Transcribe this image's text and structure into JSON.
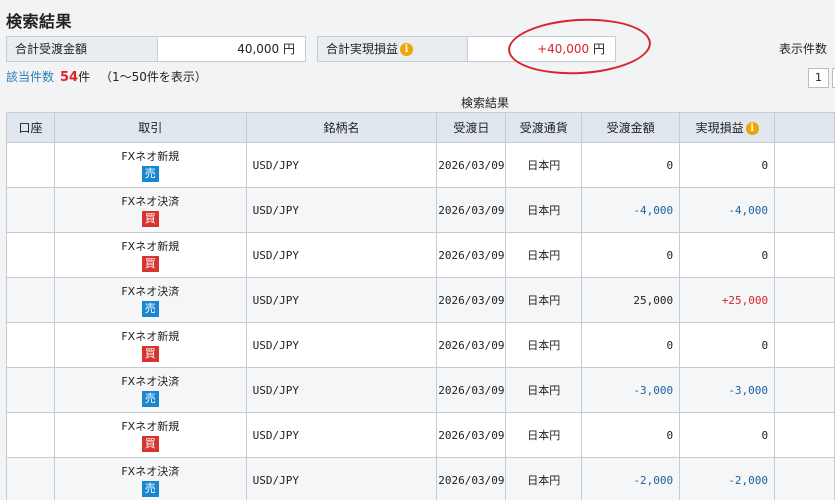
{
  "page": {
    "title": "検索結果"
  },
  "summary": {
    "receipt_label": "合計受渡金額",
    "receipt_value": "40,000 円",
    "pl_label": "合計実現損益",
    "pl_value_number": "+40,000",
    "pl_value_unit": "円",
    "display_count_label": "表示件数"
  },
  "results": {
    "count_label": "該当件数",
    "count_value": "54",
    "count_unit": "件",
    "range_text": "（1〜50件を表示）",
    "page_button": "1"
  },
  "table": {
    "caption": "検索結果",
    "headers": [
      "口座",
      "取引",
      "銘柄名",
      "受渡日",
      "受渡通貨",
      "受渡金額",
      "実現損益"
    ],
    "rows": [
      {
        "account": "",
        "trade": "FXネオ新規",
        "side": "売",
        "symbol": "USD/JPY",
        "date": "2026/03/09",
        "currency": "日本円",
        "amount": "0",
        "pl": "0"
      },
      {
        "account": "",
        "trade": "FXネオ決済",
        "side": "買",
        "symbol": "USD/JPY",
        "date": "2026/03/09",
        "currency": "日本円",
        "amount": "-4,000",
        "pl": "-4,000"
      },
      {
        "account": "",
        "trade": "FXネオ新規",
        "side": "買",
        "symbol": "USD/JPY",
        "date": "2026/03/09",
        "currency": "日本円",
        "amount": "0",
        "pl": "0"
      },
      {
        "account": "",
        "trade": "FXネオ決済",
        "side": "売",
        "symbol": "USD/JPY",
        "date": "2026/03/09",
        "currency": "日本円",
        "amount": "25,000",
        "pl": "+25,000"
      },
      {
        "account": "",
        "trade": "FXネオ新規",
        "side": "買",
        "symbol": "USD/JPY",
        "date": "2026/03/09",
        "currency": "日本円",
        "amount": "0",
        "pl": "0"
      },
      {
        "account": "",
        "trade": "FXネオ決済",
        "side": "売",
        "symbol": "USD/JPY",
        "date": "2026/03/09",
        "currency": "日本円",
        "amount": "-3,000",
        "pl": "-3,000"
      },
      {
        "account": "",
        "trade": "FXネオ新規",
        "side": "買",
        "symbol": "USD/JPY",
        "date": "2026/03/09",
        "currency": "日本円",
        "amount": "0",
        "pl": "0"
      },
      {
        "account": "",
        "trade": "FXネオ決済",
        "side": "売",
        "symbol": "USD/JPY",
        "date": "2026/03/09",
        "currency": "日本円",
        "amount": "-2,000",
        "pl": "-2,000"
      }
    ]
  },
  "colors": {
    "negative": "#1e5fa0",
    "positive": "#d8242b",
    "sell_badge": "#1a86d0",
    "buy_badge": "#d8342f",
    "info_icon": "#f0a400",
    "annotation_circle": "#d8242b"
  },
  "icons": {
    "info": "info-icon"
  }
}
